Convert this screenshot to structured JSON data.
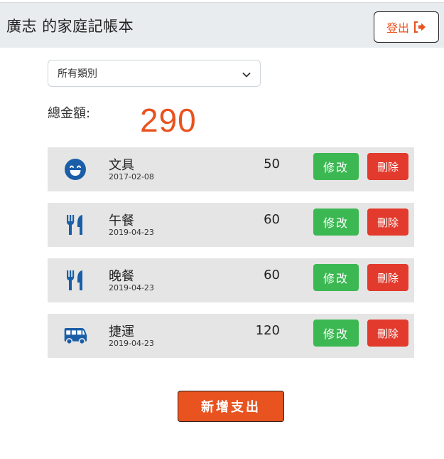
{
  "header": {
    "title": "廣志 的家庭記帳本",
    "logout_label": "登出"
  },
  "filter": {
    "selected": "所有類別"
  },
  "total": {
    "label": "總金額:",
    "value": "290"
  },
  "colors": {
    "accent": "#e8531f",
    "edit": "#3cb853",
    "delete": "#e23a2c",
    "icon": "#1a5ea8",
    "row_bg": "#e5e5e5"
  },
  "expenses": [
    {
      "icon": "smile-icon",
      "name": "文具",
      "date": "2017-02-08",
      "amount": "50",
      "edit_label": "修改",
      "delete_label": "刪除"
    },
    {
      "icon": "utensils-icon",
      "name": "午餐",
      "date": "2019-04-23",
      "amount": "60",
      "edit_label": "修改",
      "delete_label": "刪除"
    },
    {
      "icon": "utensils-icon",
      "name": "晚餐",
      "date": "2019-04-23",
      "amount": "60",
      "edit_label": "修改",
      "delete_label": "刪除"
    },
    {
      "icon": "bus-icon",
      "name": "捷運",
      "date": "2019-04-23",
      "amount": "120",
      "edit_label": "修改",
      "delete_label": "刪除"
    }
  ],
  "add_button_label": "新增支出"
}
